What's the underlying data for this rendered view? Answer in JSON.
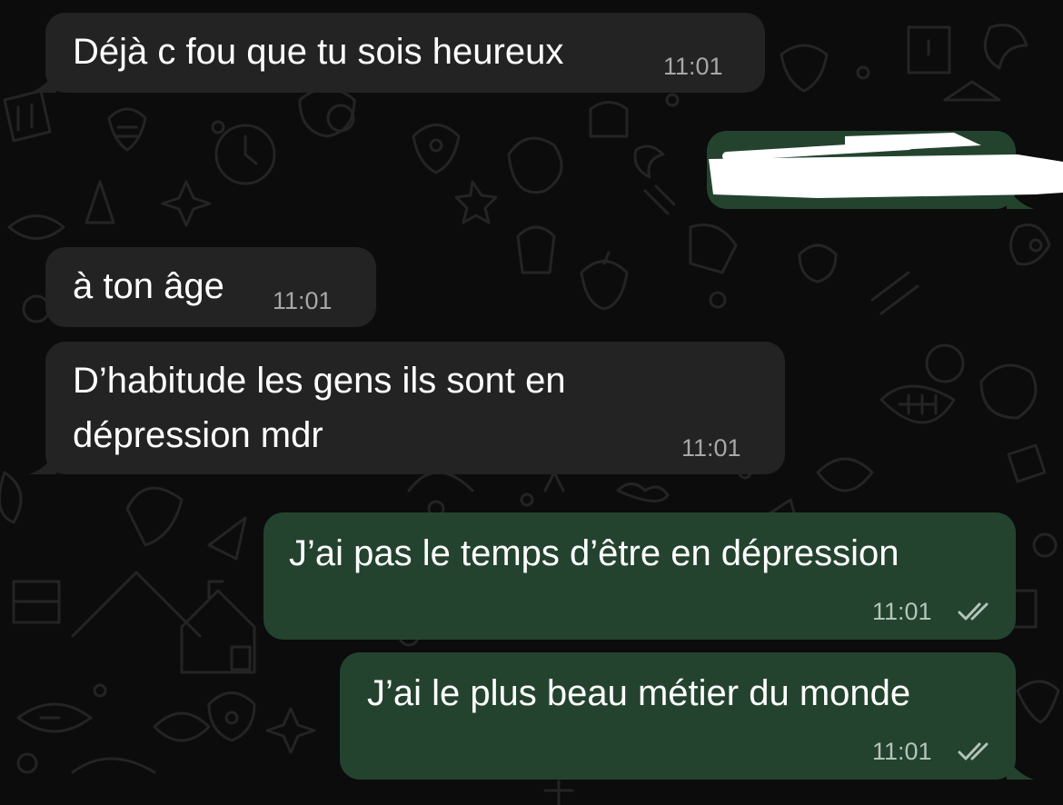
{
  "messages": [
    {
      "id": "m1",
      "direction": "incoming",
      "text": "Déjà c fou que tu sois heureux",
      "time": "11:01"
    },
    {
      "id": "m2",
      "direction": "outgoing",
      "text": "",
      "time": "",
      "redacted": true
    },
    {
      "id": "m3",
      "direction": "incoming",
      "text": "à ton âge",
      "time": "11:01"
    },
    {
      "id": "m4",
      "direction": "incoming",
      "text_lines": [
        "D’habitude les gens ils sont en",
        "dépression mdr"
      ],
      "time": "11:01"
    },
    {
      "id": "m5",
      "direction": "outgoing",
      "text": "J’ai pas le temps d’être en dépression",
      "time": "11:01",
      "status": "read-double-check-icon"
    },
    {
      "id": "m6",
      "direction": "outgoing",
      "text": "J’ai le plus beau métier du monde",
      "time": "11:01",
      "status": "read-double-check-icon"
    }
  ],
  "colors": {
    "background": "#0c0c0c",
    "incoming_bubble": "#232323",
    "outgoing_bubble": "#24432f",
    "text": "#ffffff",
    "timestamp": "#a7a7a7"
  }
}
